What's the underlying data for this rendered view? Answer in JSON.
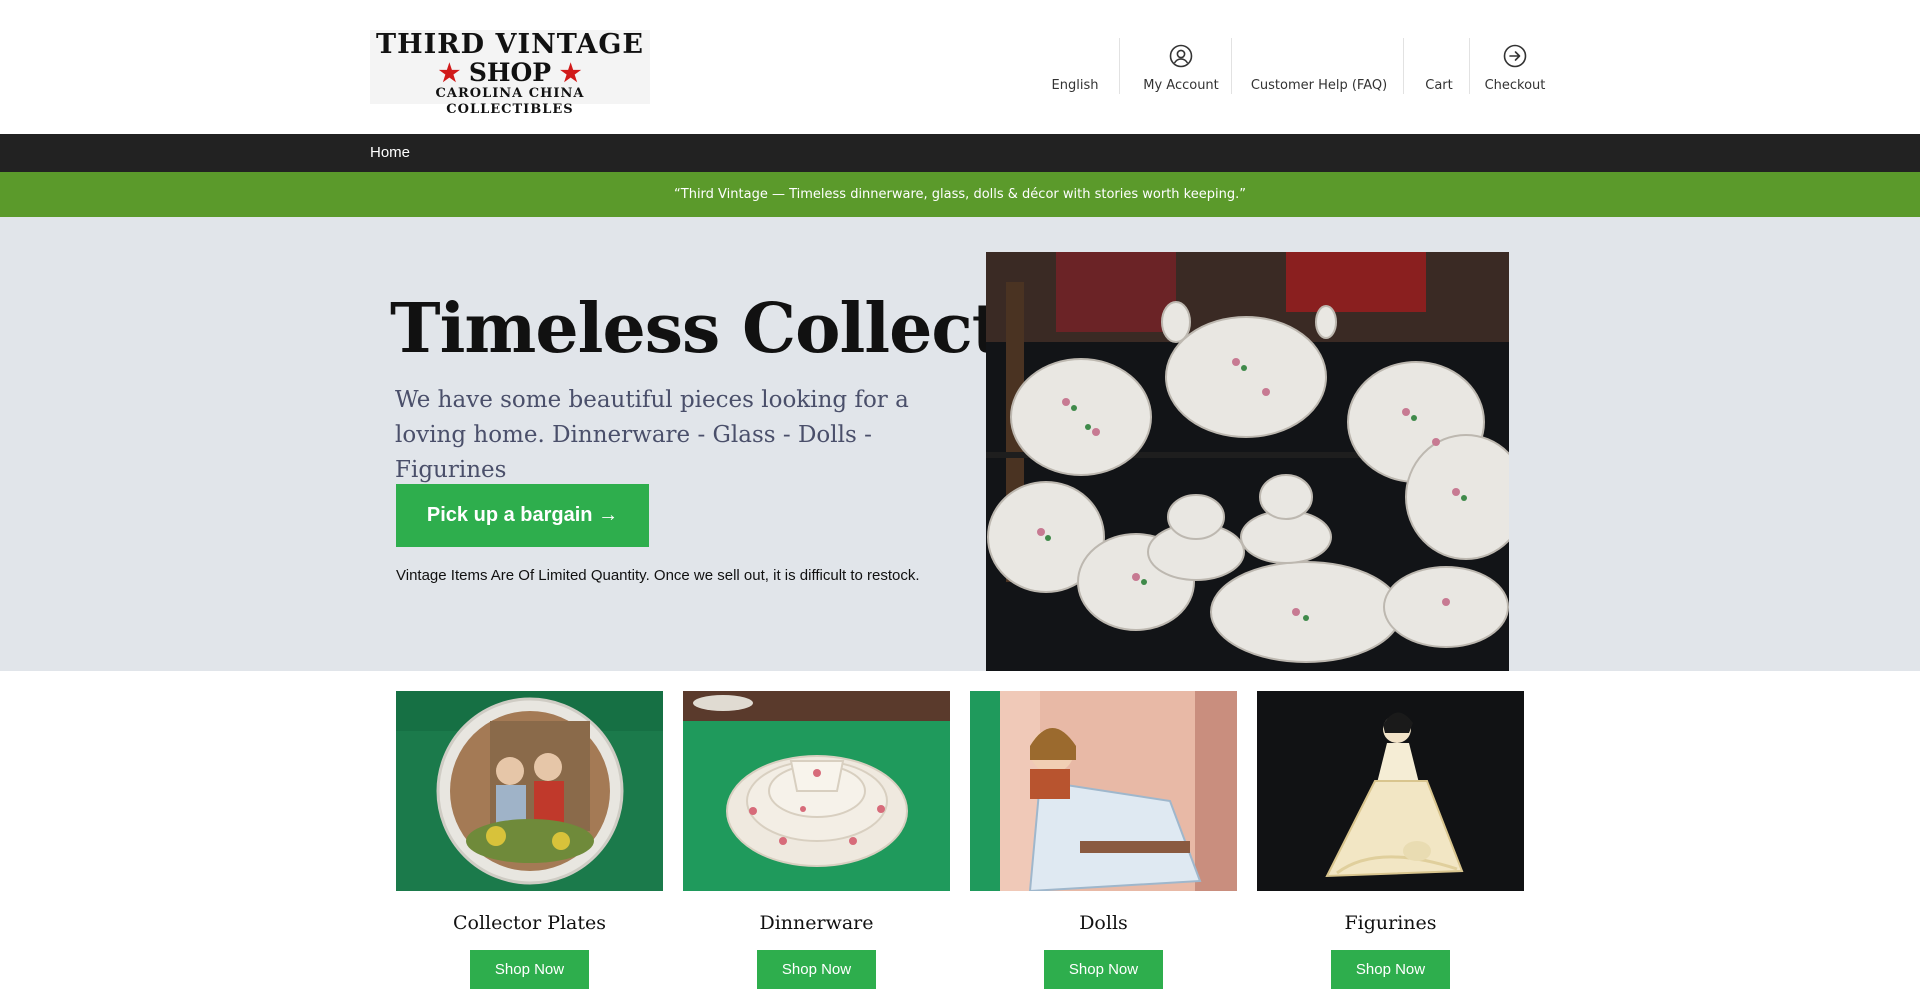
{
  "logo": {
    "line1": "THIRD VINTAGE",
    "line2": "SHOP",
    "line3": "CAROLINA CHINA COLLECTIBLES",
    "star_color": "#d11a1a"
  },
  "topnav": {
    "language": "English",
    "account": "My Account",
    "help": "Customer Help (FAQ)",
    "cart": "Cart",
    "checkout": "Checkout"
  },
  "mainnav": {
    "home": "Home"
  },
  "banner": {
    "text": "“Third Vintage — Timeless dinnerware, glass, dolls & décor with stories worth keeping.”",
    "color": "#5b9a2b"
  },
  "hero": {
    "title": "Timeless Collectibles",
    "subtitle": "We have some beautiful pieces looking for a loving home. Dinnerware - Glass - Dolls - Figurines",
    "cta": "Pick up a bargain →",
    "note": "Vintage Items Are Of Limited Quantity. Once we sell out, it is difficult to restock.",
    "image_icon": "china-display-photo",
    "accent": "#2eae4d"
  },
  "categories": [
    {
      "name": "Collector Plates",
      "button": "Shop Now",
      "image_icon": "collector-plate-photo"
    },
    {
      "name": "Dinnerware",
      "button": "Shop Now",
      "image_icon": "teacup-set-photo"
    },
    {
      "name": "Dolls",
      "button": "Shop Now",
      "image_icon": "doll-in-box-photo"
    },
    {
      "name": "Figurines",
      "button": "Shop Now",
      "image_icon": "figurine-photo"
    }
  ]
}
